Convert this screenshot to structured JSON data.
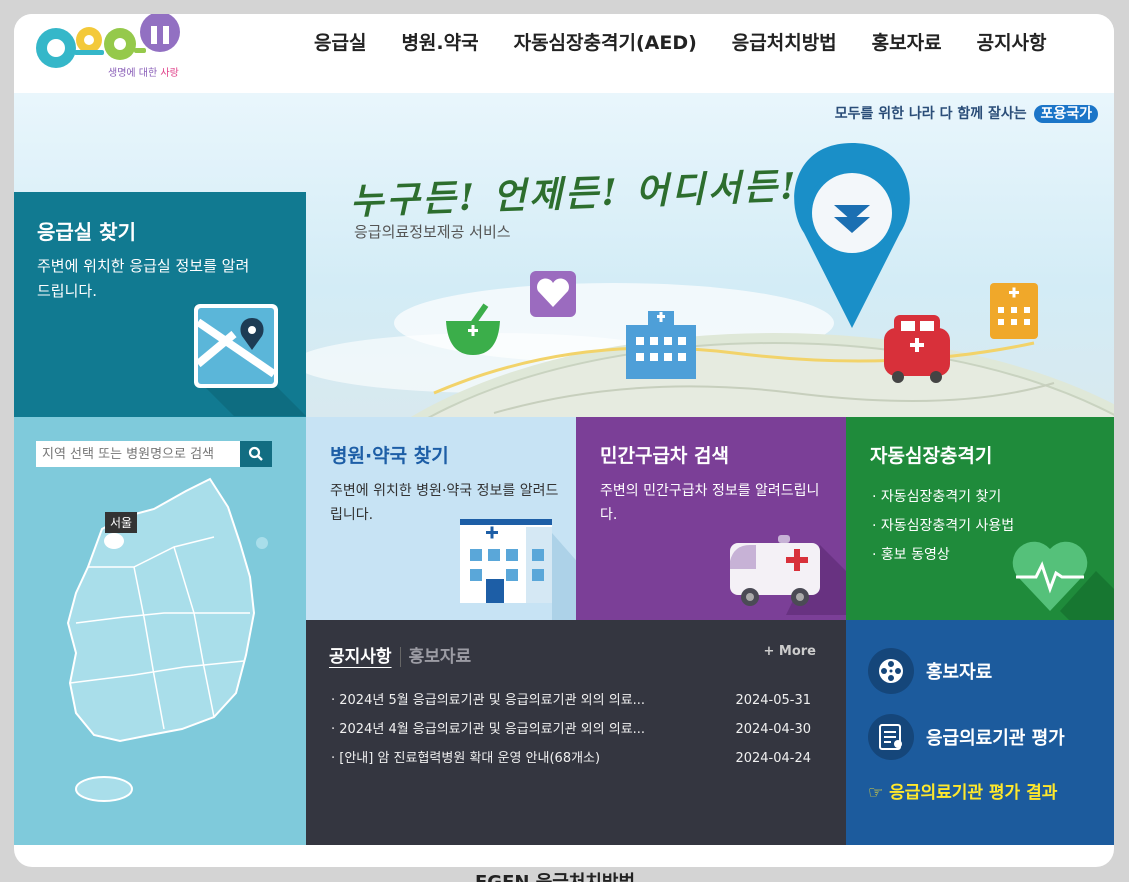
{
  "header": {
    "logo_text": "E-GEN",
    "logo_tagline_a": "생명에 대한",
    "logo_tagline_b": "사랑",
    "nav": [
      "응급실",
      "병원.약국",
      "자동심장충격기(AED)",
      "응급처치방법",
      "홍보자료",
      "공지사항"
    ]
  },
  "hero": {
    "slogan": "모두를 위한 나라 다 함께 잘사는",
    "slogan_badge": "포용국가",
    "headline": "누구든! 언제든! 어디서든!",
    "subtitle": "응급의료정보제공 서비스"
  },
  "er_card": {
    "title": "응급실 찾기",
    "desc": "주변에 위치한 응급실 정보를 알려드립니다."
  },
  "map": {
    "search_placeholder": "지역 선택 또는 병원명으로 검색",
    "marker_label": "서울"
  },
  "tiles": {
    "hospital": {
      "title": "병원·약국 찾기",
      "desc": "주변에 위치한 병원·약국 정보를 알려드립니다."
    },
    "ambulance": {
      "title": "민간구급차 검색",
      "desc": "주변의 민간구급차 정보를 알려드립니다."
    },
    "aed": {
      "title": "자동심장충격기",
      "items": [
        "자동심장충격기 찾기",
        "자동심장충격기 사용법",
        "홍보 동영상"
      ]
    }
  },
  "notice": {
    "tab_active": "공지사항",
    "tab_inactive": "홍보자료",
    "more": "+ More",
    "items": [
      {
        "title": "2024년 5월 응급의료기관 및 응급의료기관 외의 의료...",
        "date": "2024-05-31"
      },
      {
        "title": "2024년 4월 응급의료기관 및 응급의료기관 외의 의료...",
        "date": "2024-04-30"
      },
      {
        "title": "[안내] 암 진료협력병원 확대 운영 안내(68개소)",
        "date": "2024-04-24"
      }
    ]
  },
  "promo": {
    "pr_label": "홍보자료",
    "eval_label": "응급의료기관 평가",
    "result_link": "☞ 응급의료기관 평가 결과"
  },
  "footer_peek": "EGEN 응급처치방법",
  "colors": {
    "er_teal": "#117a91",
    "map_bg": "#7fcadb",
    "hospital_tile": "#c7e3f4",
    "ambulance_tile": "#7b3f97",
    "aed_tile": "#1f8b3b",
    "notice_bg": "#343640",
    "promo_bg": "#1c5b9d",
    "promo_link": "#ffe82b"
  }
}
